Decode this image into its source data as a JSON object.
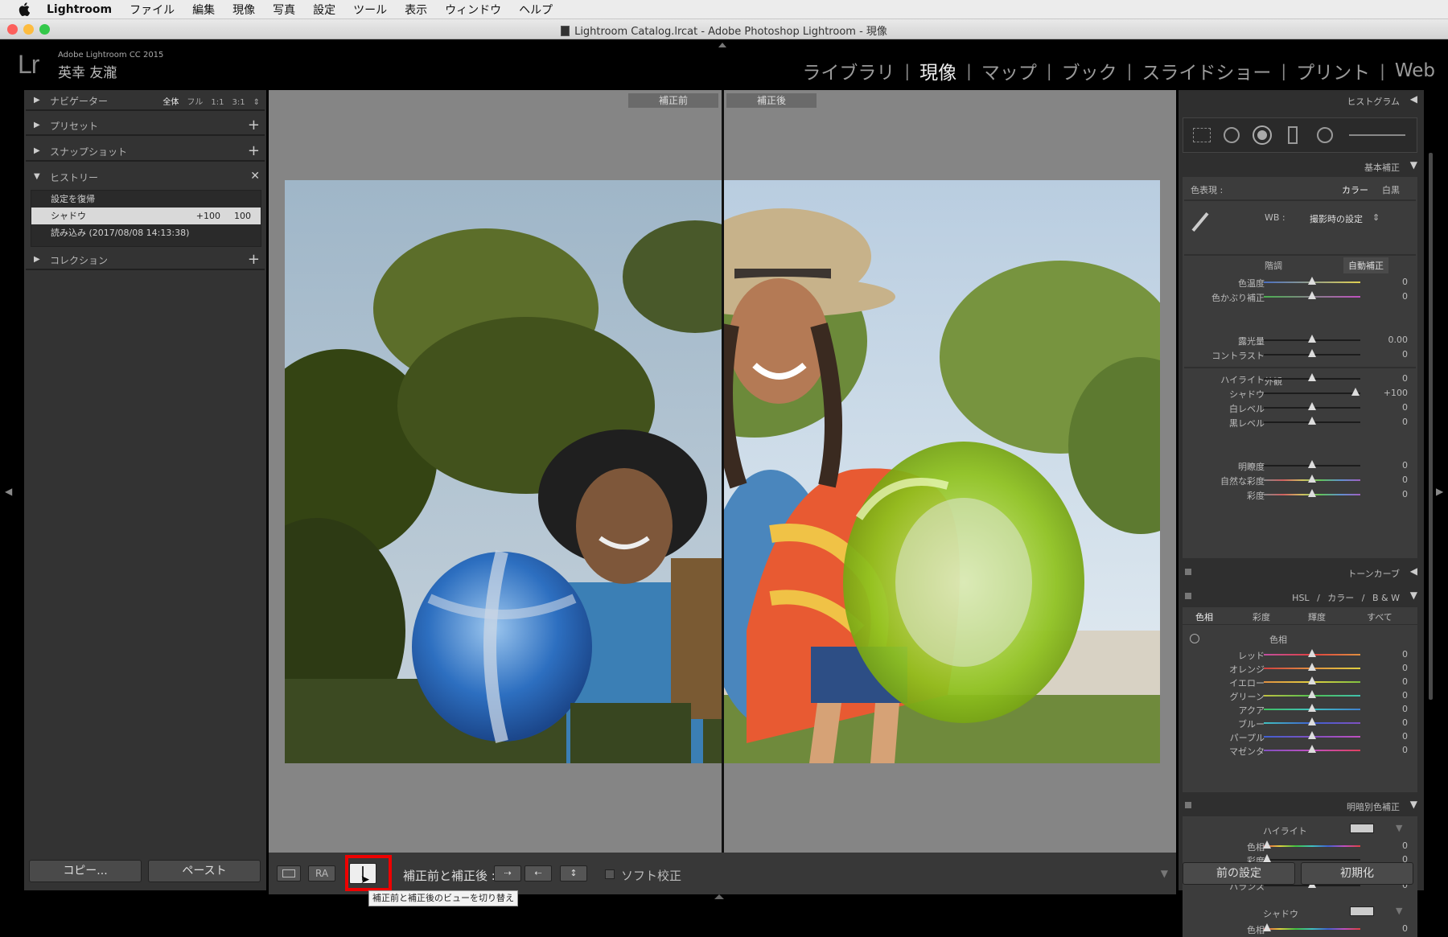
{
  "menubar": {
    "items": [
      "Lightroom",
      "ファイル",
      "編集",
      "現像",
      "写真",
      "設定",
      "ツール",
      "表示",
      "ウィンドウ",
      "ヘルプ"
    ]
  },
  "window": {
    "title": "Lightroom Catalog.lrcat - Adobe Photoshop Lightroom - 現像"
  },
  "identity": {
    "logo": "Lr",
    "product": "Adobe Lightroom CC 2015",
    "user": "英幸 友瀧"
  },
  "modules": [
    "ライブラリ",
    "現像",
    "マップ",
    "ブック",
    "スライドショー",
    "プリント",
    "Web"
  ],
  "active_module": "現像",
  "left_panel": {
    "navigator": {
      "label": "ナビゲーター",
      "zoom_options": [
        "全体",
        "フル",
        "1:1",
        "3:1"
      ]
    },
    "presets": {
      "label": "プリセット"
    },
    "snapshots": {
      "label": "スナップショット"
    },
    "history": {
      "label": "ヒストリー",
      "items": [
        {
          "label": "設定を復帰",
          "v1": "",
          "v2": ""
        },
        {
          "label": "シャドウ",
          "v1": "+100",
          "v2": "100"
        },
        {
          "label": "読み込み (2017/08/08 14:13:38)",
          "v1": "",
          "v2": ""
        }
      ]
    },
    "collections": {
      "label": "コレクション"
    },
    "copy_button": "コピー...",
    "paste_button": "ペースト"
  },
  "center": {
    "before_label": "補正前",
    "after_label": "補正後",
    "toolbar": {
      "before_after_label": "補正前と補正後 :",
      "softproof_label": "ソフト校正",
      "ra_label": "RA"
    },
    "tooltip": "補正前と補正後のビューを切り替え"
  },
  "right_panel": {
    "histogram_label": "ヒストグラム",
    "basic": {
      "label": "基本補正",
      "treatment_label": "色表現 :",
      "treatment_color": "カラー",
      "treatment_bw": "白黒",
      "wb_label": "WB :",
      "wb_value": "撮影時の設定",
      "tone_label": "階調",
      "auto_label": "自動補正",
      "presence_label": "外観",
      "sliders": [
        {
          "name": "色温度",
          "value": "0",
          "pos": 0.5
        },
        {
          "name": "色かぶり補正",
          "value": "0",
          "pos": 0.5
        },
        {
          "name": "露光量",
          "value": "0.00",
          "pos": 0.5
        },
        {
          "name": "コントラスト",
          "value": "0",
          "pos": 0.5
        },
        {
          "name": "ハイライト",
          "value": "0",
          "pos": 0.5
        },
        {
          "name": "シャドウ",
          "value": "+100",
          "pos": 0.95
        },
        {
          "name": "白レベル",
          "value": "0",
          "pos": 0.5
        },
        {
          "name": "黒レベル",
          "value": "0",
          "pos": 0.5
        },
        {
          "name": "明瞭度",
          "value": "0",
          "pos": 0.5
        },
        {
          "name": "自然な彩度",
          "value": "0",
          "pos": 0.5
        },
        {
          "name": "彩度",
          "value": "0",
          "pos": 0.5
        }
      ]
    },
    "tonecurve_label": "トーンカーブ",
    "hsl": {
      "header": [
        "HSL",
        "/",
        "カラー",
        "/",
        "B & W"
      ],
      "tabs": [
        "色相",
        "彩度",
        "輝度",
        "すべて"
      ],
      "sub_label": "色相",
      "sliders": [
        {
          "name": "レッド",
          "value": "0"
        },
        {
          "name": "オレンジ",
          "value": "0"
        },
        {
          "name": "イエロー",
          "value": "0"
        },
        {
          "name": "グリーン",
          "value": "0"
        },
        {
          "name": "アクア",
          "value": "0"
        },
        {
          "name": "ブルー",
          "value": "0"
        },
        {
          "name": "パープル",
          "value": "0"
        },
        {
          "name": "マゼンタ",
          "value": "0"
        }
      ]
    },
    "split": {
      "label": "明暗別色補正",
      "highlight_label": "ハイライト",
      "shadow_label": "シャドウ",
      "balance_label": "バランス",
      "highlight_sliders": [
        {
          "name": "色相",
          "value": "0"
        },
        {
          "name": "彩度",
          "value": "0"
        }
      ],
      "balance_value": "0",
      "shadow_sliders": [
        {
          "name": "色相",
          "value": "0"
        }
      ]
    },
    "previous_button": "前の設定",
    "reset_button": "初期化"
  }
}
